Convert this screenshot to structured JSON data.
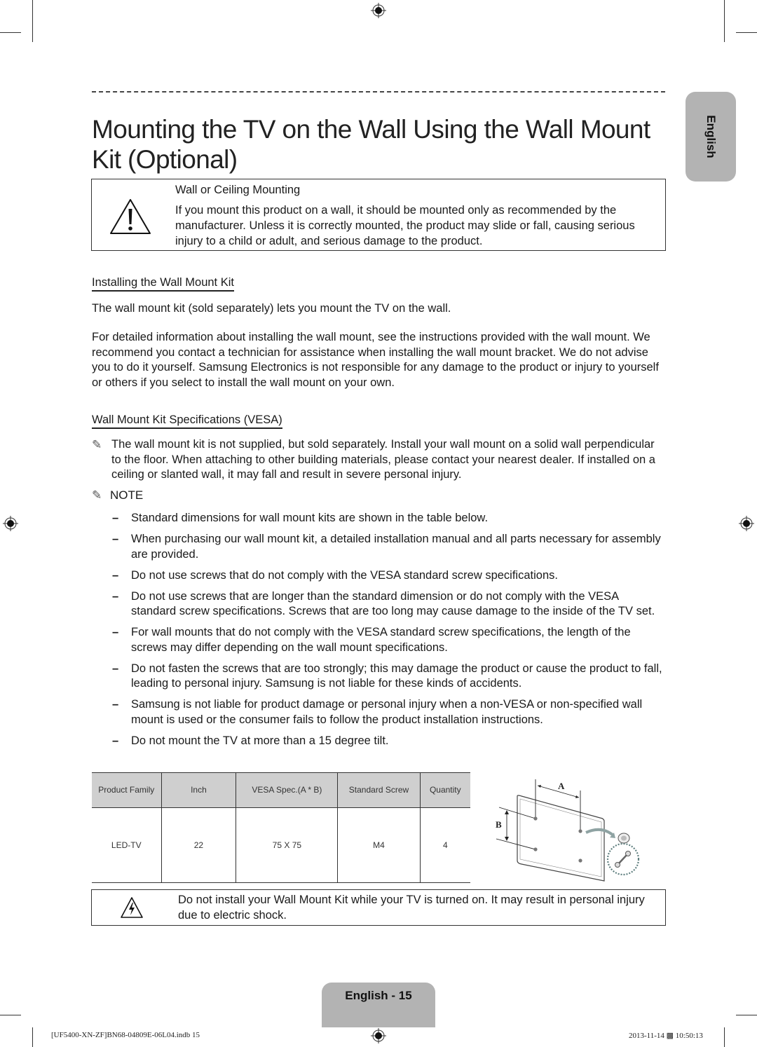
{
  "page": {
    "title": "Mounting the TV on the Wall Using the Wall Mount Kit (Optional)",
    "language_tab": "English",
    "page_tab": "English - 15"
  },
  "warning_box": {
    "icon": "warning-triangle-icon",
    "title": "Wall or Ceiling Mounting",
    "body": "If you mount this product on a wall, it should be mounted only as recommended by the manufacturer. Unless it is correctly mounted, the product may slide or fall, causing serious injury to a child or adult, and serious damage to the product."
  },
  "installing": {
    "heading": "Installing the Wall Mount Kit",
    "para1": "The wall mount kit (sold separately) lets you mount the TV on the wall.",
    "para2": "For detailed information about installing the wall mount, see the instructions provided with the wall mount. We recommend you contact a technician for assistance when installing the wall mount bracket. We do not advise you to do it yourself. Samsung Electronics is not responsible for any damage to the product or injury to yourself or others if you select to install the wall mount on your own."
  },
  "specs": {
    "heading": "Wall Mount Kit Specifications (VESA)",
    "note_icon": "pencil-note-icon",
    "intro": "The wall mount kit is not supplied, but sold separately. Install your wall mount on a solid wall perpendicular to the floor. When attaching to other building materials, please contact your nearest dealer. If installed on a ceiling or slanted wall, it may fall and result in severe personal injury.",
    "note_label": "NOTE",
    "bullet_marker": "–",
    "bullets": [
      "Standard dimensions for wall mount kits are shown in the table below.",
      "When purchasing our wall mount kit, a detailed installation manual and all parts necessary for assembly are provided.",
      "Do not use screws that do not comply with the VESA standard screw specifications.",
      "Do not use screws that are longer than the standard dimension or do not comply with the VESA standard screw specifications. Screws that are too long may cause damage to the inside of the TV set.",
      "For wall mounts that do not comply with the VESA standard screw specifications, the length of the screws may differ depending on the wall mount specifications.",
      "Do not fasten the screws that are too strongly; this may damage the product or cause the product to fall, leading to personal injury. Samsung is not liable for these kinds of accidents.",
      "Samsung is not liable for product damage or personal injury when a non-VESA or non-specified wall mount is used or the consumer fails to follow the product installation instructions.",
      "Do not mount the TV at more than a 15 degree tilt."
    ]
  },
  "table": {
    "headers": [
      "Product Family",
      "Inch",
      "VESA Spec.(A * B)",
      "Standard Screw",
      "Quantity"
    ],
    "rows": [
      [
        "LED-TV",
        "22",
        "75 X 75",
        "M4",
        "4"
      ]
    ]
  },
  "diagram": {
    "label_a": "A",
    "label_b": "B"
  },
  "shock_box": {
    "icon": "electric-shock-warning-icon",
    "body": "Do not install your Wall Mount Kit while your TV is turned on. It may result in personal injury due to electric shock."
  },
  "footer": {
    "file": "[UF5400-XN-ZF]BN68-04809E-06L04.indb   15",
    "timestamp": "2013-11-14   ▩ 10:50:13"
  }
}
